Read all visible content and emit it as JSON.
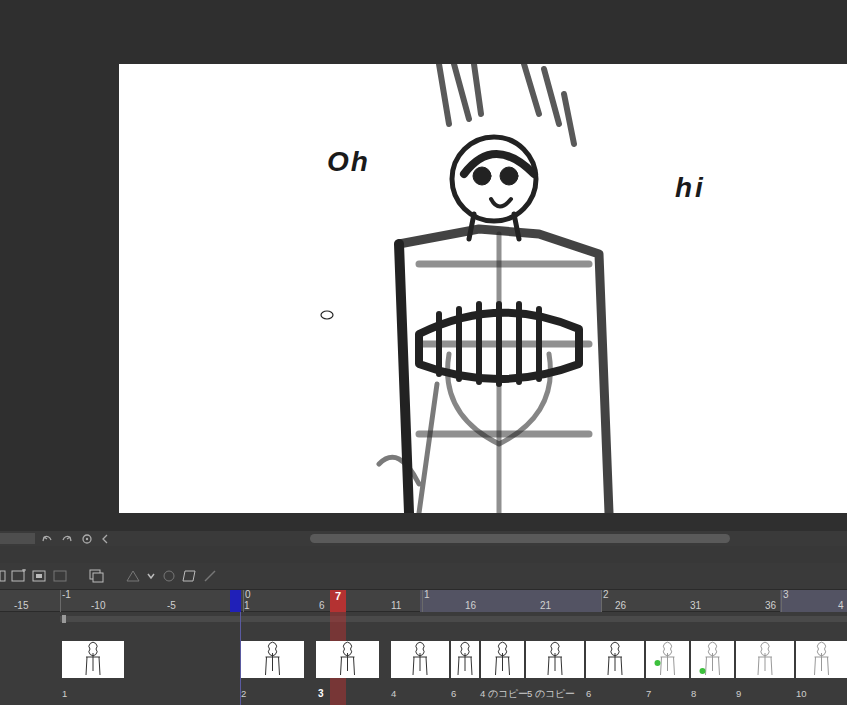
{
  "canvas": {
    "annotations": [
      {
        "text": "Oh"
      },
      {
        "text": "hi"
      }
    ]
  },
  "ruler": {
    "seconds": [
      "-1",
      "0",
      "1",
      "2",
      "3"
    ],
    "frames": [
      "-15",
      "-10",
      "-5",
      "1",
      "6",
      "11",
      "16",
      "21",
      "26",
      "31",
      "36",
      "4"
    ],
    "current_frame": "7"
  },
  "cels": [
    {
      "label": "1",
      "selected": false
    },
    {
      "label": "2",
      "selected": false
    },
    {
      "label": "3",
      "selected": true
    },
    {
      "label": "4",
      "selected": false
    },
    {
      "label": "6",
      "selected": false
    },
    {
      "label": "4 のコピー",
      "selected": false
    },
    {
      "label": "5 のコピー",
      "selected": false
    },
    {
      "label": "6",
      "selected": false
    },
    {
      "label": "7",
      "selected": false
    },
    {
      "label": "8",
      "selected": false
    },
    {
      "label": "9",
      "selected": false
    },
    {
      "label": "10",
      "selected": false
    }
  ]
}
